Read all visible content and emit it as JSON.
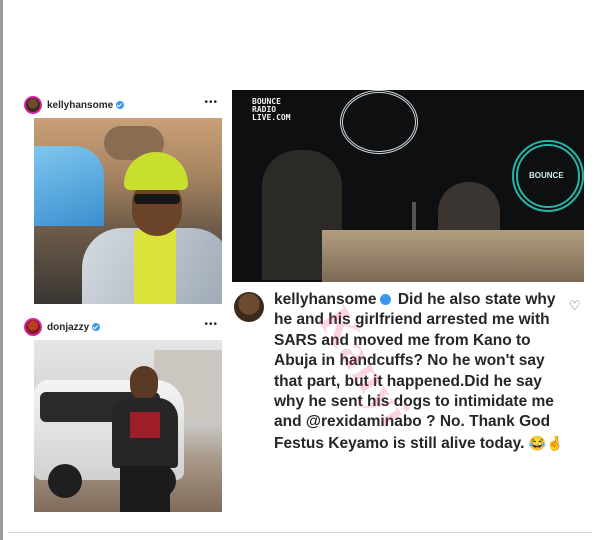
{
  "cards": {
    "kelly": {
      "handle": "kellyhansome",
      "more": "•••"
    },
    "don": {
      "handle": "donjazzy",
      "more": "•••"
    }
  },
  "studio": {
    "logo_line1": "BOUNCE",
    "logo_line2": "RADIO",
    "logo_line3": "LIVE.COM",
    "ring_label": "BOUNCE"
  },
  "comment": {
    "handle": "kellyhansome",
    "text": "Did he also state why he and his girlfriend arrested me with SARS and moved me from Kano to Abuja in handcuffs? No he won't say that part, but it happened.Did he say why he sent his dogs to intimidate me and @rexidaminabo ? No. Thank God Festus Keyamo is still alive today.",
    "emojis": "😂🤞"
  },
  "watermark": "Kanyi"
}
